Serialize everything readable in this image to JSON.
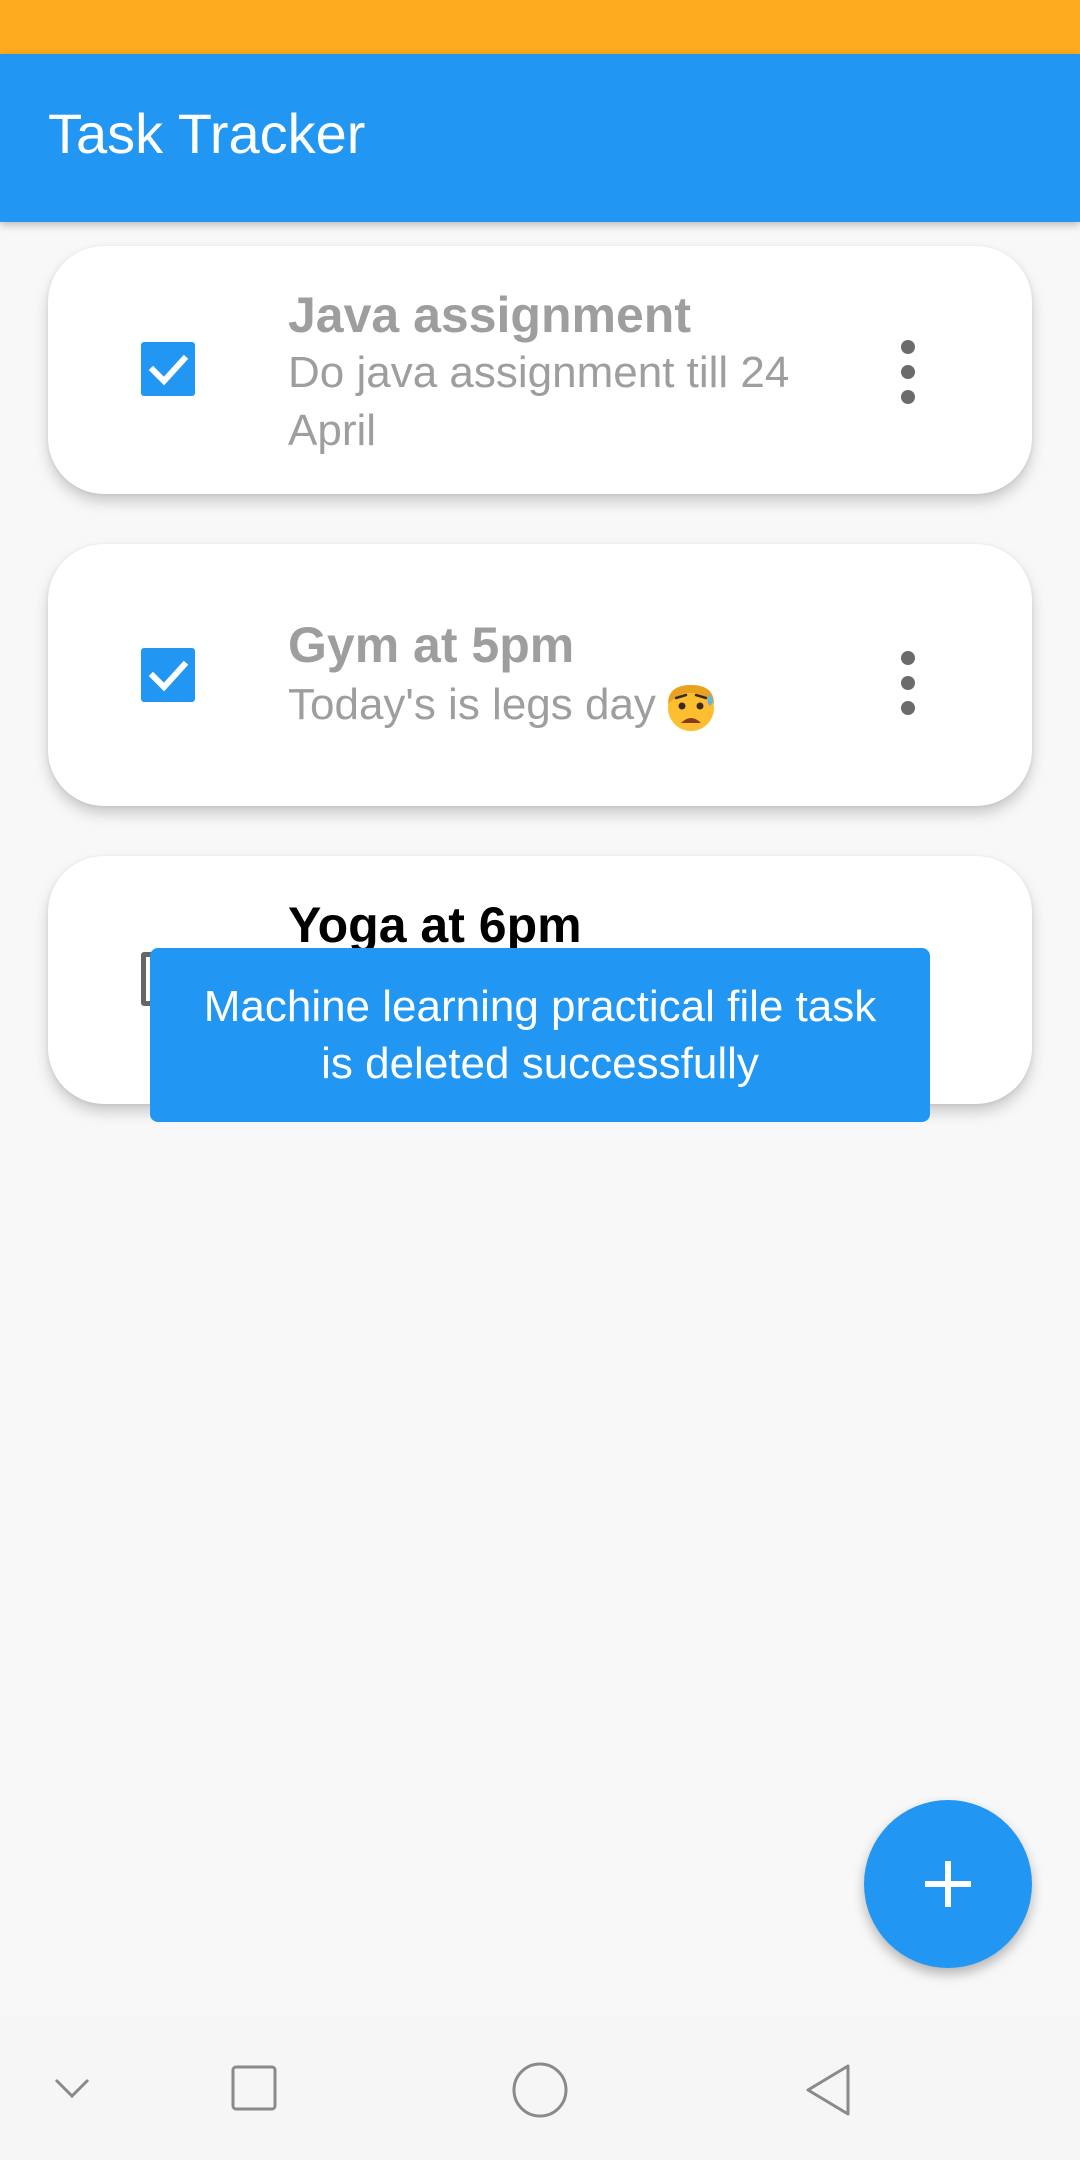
{
  "app": {
    "title": "Task Tracker",
    "colors": {
      "primary": "#2196F3",
      "status_bar": "#FFAB1F",
      "completed_text": "#9e9e9e",
      "emoji_face": "#FDBE2F"
    }
  },
  "tasks": [
    {
      "title": "Java assignment",
      "description": "Do java assignment till 24 April",
      "completed": true,
      "menu_icon": "more-vert-icon"
    },
    {
      "title": "Gym at 5pm",
      "description": "Today's is legs day",
      "emoji": "anxious-face-with-sweat",
      "completed": true,
      "menu_icon": "more-vert-icon"
    },
    {
      "title": "Yoga at 6pm",
      "completed": false,
      "menu_icon": "more-vert-icon"
    }
  ],
  "toast": {
    "message": "Machine learning practical file task is deleted successfully"
  },
  "fab": {
    "icon": "plus-icon"
  },
  "system_nav": {
    "buttons": [
      "collapse-icon",
      "recents-icon",
      "home-icon",
      "back-icon"
    ]
  }
}
